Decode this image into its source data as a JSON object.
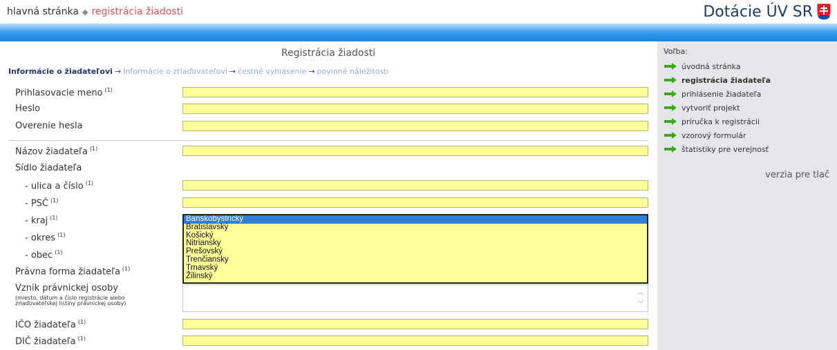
{
  "breadcrumb": {
    "home": "hlavná stránka",
    "separator": "◆",
    "current": "registrácia žiadosti"
  },
  "brand": {
    "title": "Dotácie ÚV SR"
  },
  "form": {
    "title": "Registrácia žiadosti",
    "steps": [
      "Informácie o žiadateľovi",
      "Informácie o zriaďovateľovi",
      "čestné vyhlásenie",
      "povinné náležitosti"
    ],
    "step_arrow": "→",
    "req_mark": "(1)",
    "labels": {
      "login": "Prihlasovacie meno",
      "password": "Heslo",
      "password_confirm": "Overenie hesla",
      "name": "Názov žiadateľa",
      "seat": "Sídlo žiadateľa",
      "street": "- ulica a číslo",
      "psc": "- PSČ",
      "kraj": "- kraj",
      "okres": "- okres",
      "obec": "- obec",
      "legal_form": "Právna forma žiadateľa",
      "origin": "Vznik právnickej osoby",
      "origin_note": "(miesto, dátum a číslo registrácie alebo zriaďovateľskej listiny právnickej osoby)",
      "ico": "IČO žiadateľa",
      "dic": "DIČ žiadateľa"
    },
    "kraj_options": [
      "Banskobystrický",
      "Bratislavský",
      "Košický",
      "Nitriansky",
      "Prešovský",
      "Trenčiansky",
      "Trnavský",
      "Žilinský"
    ],
    "kraj_selected": "Banskobystrický"
  },
  "sidebar": {
    "heading": "Voľba:",
    "items": [
      "úvodná stránka",
      "registrácia žiadateľa",
      "prihlásenie žiadateľa",
      "vytvoriť projekt",
      "príručka k registrácii",
      "vzorový formulár",
      "štatistiky pre verejnosť"
    ],
    "active_item": "registrácia žiadateľa",
    "print_link": "verzia pre tlač"
  },
  "colors": {
    "input_bg": "#ffff99",
    "band": "#1a82e0",
    "arrow": "#3aaa1a",
    "breadcrumb_current": "#e05050"
  }
}
